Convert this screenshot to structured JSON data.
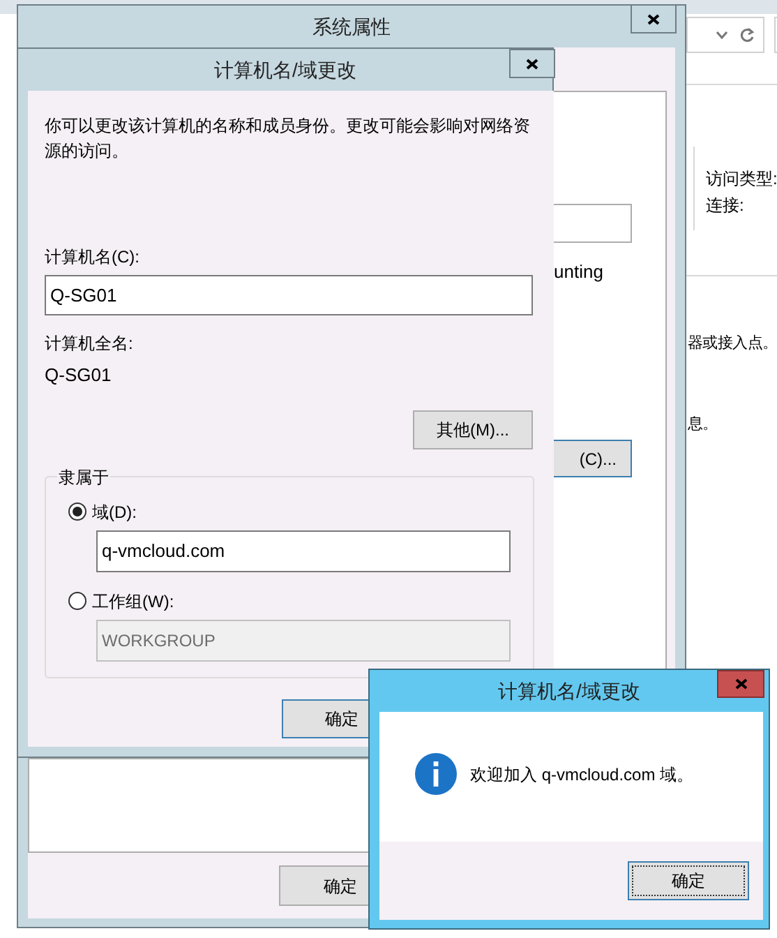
{
  "background_window": {
    "labels": [
      "访问类型:",
      "连接:"
    ],
    "texts": [
      "器或接入点。",
      "息。"
    ]
  },
  "system_properties": {
    "title": "系统属性",
    "text_fragment": "unting",
    "change_button": "(C)...",
    "ok_button": "确定"
  },
  "computer_name_dialog": {
    "title": "计算机名/域更改",
    "description": "你可以更改该计算机的名称和成员身份。更改可能会影响对网络资源的访问。",
    "computer_name_label": "计算机名(C):",
    "computer_name": "Q-SG01",
    "full_name_label": "计算机全名:",
    "full_name": "Q-SG01",
    "more_button": "其他(M)...",
    "member_of": {
      "legend": "隶属于",
      "options": [
        {
          "label": "域(D):",
          "selected": true,
          "value": "q-vmcloud.com"
        },
        {
          "label": "工作组(W):",
          "selected": false,
          "value": "WORKGROUP"
        }
      ]
    },
    "ok_button": "确定"
  },
  "message_box": {
    "title": "计算机名/域更改",
    "message": "欢迎加入 q-vmcloud.com 域。",
    "ok_button": "确定"
  }
}
